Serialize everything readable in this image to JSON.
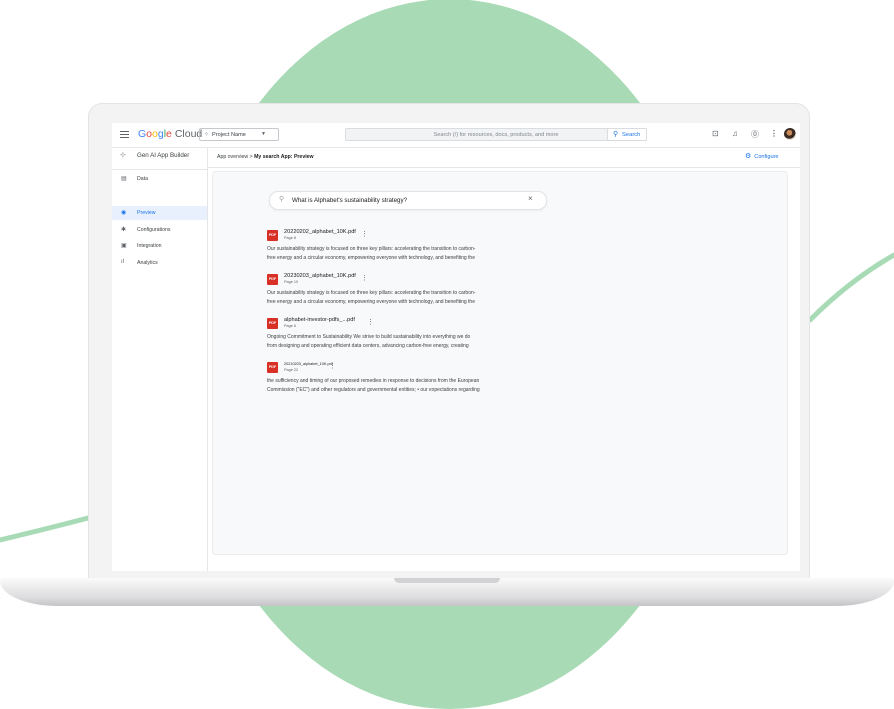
{
  "header": {
    "logo": "Google Cloud",
    "project": "Project Name",
    "search_placeholder": "Search (/) for resources, docs, products, and more",
    "search_button": "Search"
  },
  "sidebar": {
    "title": "Gen AI App Builder",
    "items": [
      {
        "label": "Data",
        "icon": "database-icon"
      },
      {
        "label": "Preview",
        "icon": "eye-icon",
        "active": true
      },
      {
        "label": "Configurations",
        "icon": "gear-icon"
      },
      {
        "label": "Integration",
        "icon": "integration-icon"
      },
      {
        "label": "Analytics",
        "icon": "bar-chart-icon"
      }
    ]
  },
  "breadcrumb": {
    "root": "App overview",
    "separator": ">",
    "current": "My search App: Preview"
  },
  "configure_label": "Configure",
  "query": "What is Alphabet's sustainability strategy?",
  "results": [
    {
      "file": "20220202_alphabet_10K.pdf",
      "page": "Page 8",
      "line1": "Our sustainability strategy is focused on three key pillars: accelerating the transition to carbon-",
      "line2": "free energy and a circular economy, empowering everyone with technology, and benefiting the"
    },
    {
      "file": "20230203_alphabet_10K.pdf",
      "page": "Page 10",
      "line1": "Our sustainability strategy is focused on three key pillars: accelerating the transition to carbon-",
      "line2": "free energy and a circular economy, empowering everyone with technology, and benefiting the"
    },
    {
      "file": "alphabet-investor-pdfs_...pdf",
      "page": "Page 6",
      "line1": "Ongoing Commitment to Sustainability We strive to build sustainability into everything we do",
      "line2": "from designing and operating efficient data centers, advancing carbon-free energy, creating"
    },
    {
      "file": "20210203_alphabet_10K.pdf",
      "page": "Page 22",
      "line1": "the sufficiency and timing of our proposed remedies in response to decisions from the European",
      "line2": "Commission (\"EC\") and other regulators and governmental entities; • our expectations regarding"
    }
  ],
  "pdf_badge": "PDF",
  "colors": {
    "accent": "#1a73e8",
    "pdf_red": "#d93025",
    "background_circle": "#a8dbb5",
    "active_nav_bg": "#e8f0fe"
  }
}
